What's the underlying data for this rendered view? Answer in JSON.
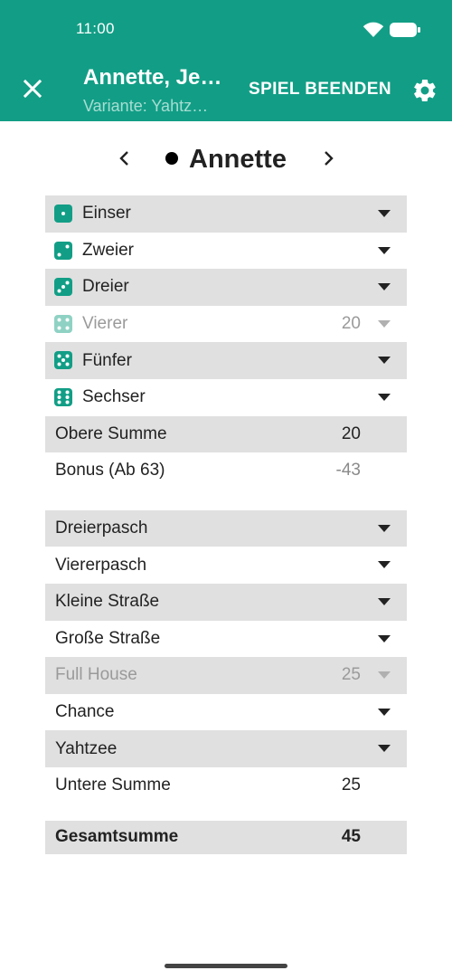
{
  "status_bar": {
    "time": "11:00"
  },
  "app_bar": {
    "title": "Annette, Je…",
    "subtitle": "Variante: Yahtz…",
    "end_game_label": "SPIEL BEENDEN",
    "close_icon": "close-icon",
    "settings_icon": "gear-icon",
    "color": "#129e86"
  },
  "player": {
    "name": "Annette",
    "prev_icon": "chevron-left-icon",
    "next_icon": "chevron-right-icon"
  },
  "upper_section": {
    "rows": [
      {
        "label": "Einser",
        "value": "",
        "die": 1,
        "disabled": false
      },
      {
        "label": "Zweier",
        "value": "",
        "die": 2,
        "disabled": false
      },
      {
        "label": "Dreier",
        "value": "",
        "die": 3,
        "disabled": false
      },
      {
        "label": "Vierer",
        "value": "20",
        "die": 4,
        "disabled": true
      },
      {
        "label": "Fünfer",
        "value": "",
        "die": 5,
        "disabled": false
      },
      {
        "label": "Sechser",
        "value": "",
        "die": 6,
        "disabled": false
      }
    ],
    "sum_label": "Obere Summe",
    "sum_value": "20",
    "bonus_label": "Bonus (Ab 63)",
    "bonus_value": "-43"
  },
  "lower_section": {
    "rows": [
      {
        "label": "Dreierpasch",
        "value": "",
        "disabled": false
      },
      {
        "label": "Viererpasch",
        "value": "",
        "disabled": false
      },
      {
        "label": "Kleine Straße",
        "value": "",
        "disabled": false
      },
      {
        "label": "Große Straße",
        "value": "",
        "disabled": false
      },
      {
        "label": "Full House",
        "value": "25",
        "disabled": true
      },
      {
        "label": "Chance",
        "value": "",
        "disabled": false
      },
      {
        "label": "Yahtzee",
        "value": "",
        "disabled": false
      }
    ],
    "sum_label": "Untere Summe",
    "sum_value": "25"
  },
  "total": {
    "label": "Gesamtsumme",
    "value": "45"
  }
}
